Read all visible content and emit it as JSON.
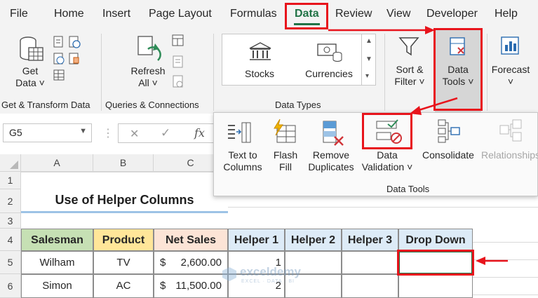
{
  "menu": {
    "tabs": [
      "File",
      "Home",
      "Insert",
      "Page Layout",
      "Formulas",
      "Data",
      "Review",
      "View",
      "Developer",
      "Help"
    ],
    "active": "Data"
  },
  "ribbon": {
    "get_data": {
      "line1": "Get",
      "line2": "Data ˅"
    },
    "group_get_transform": "Get & Transform Data",
    "refresh": {
      "line1": "Refresh",
      "line2": "All ˅"
    },
    "group_queries": "Queries & Connections",
    "stocks": "Stocks",
    "currencies": "Currencies",
    "group_data_types": "Data Types",
    "sort_filter": {
      "line1": "Sort &",
      "line2": "Filter ˅"
    },
    "data_tools": {
      "line1": "Data",
      "line2": "Tools ˅"
    },
    "forecast": {
      "line1": "Forecast",
      "line2": "˅"
    }
  },
  "popup": {
    "text_to_columns": {
      "line1": "Text to",
      "line2": "Columns"
    },
    "flash_fill": {
      "line1": "Flash",
      "line2": "Fill"
    },
    "remove_duplicates": {
      "line1": "Remove",
      "line2": "Duplicates"
    },
    "data_validation": {
      "line1": "Data",
      "line2": "Validation ˅"
    },
    "consolidate": "Consolidate",
    "relationships": "Relationships",
    "group_label": "Data Tools"
  },
  "formula_bar": {
    "name_box": "G5",
    "cancel": "✕",
    "enter": "✓",
    "fx": "fx"
  },
  "grid": {
    "columns": [
      "A",
      "B",
      "C"
    ],
    "rows": [
      "1",
      "2",
      "3",
      "4",
      "5",
      "6"
    ],
    "title": "Use of Helper Columns",
    "headers": [
      "Salesman",
      "Product",
      "Net Sales",
      "Helper 1",
      "Helper 2",
      "Helper 3",
      "Drop Down"
    ],
    "data": [
      {
        "salesman": "Wilham",
        "product": "TV",
        "currency": "$",
        "net_sales": "2,600.00",
        "helper1": "1"
      },
      {
        "salesman": "Simon",
        "product": "AC",
        "currency": "$",
        "net_sales": "11,500.00",
        "helper1": "2"
      }
    ]
  },
  "watermark": {
    "brand": "exceldemy",
    "tagline": "EXCEL · DATA · BI"
  },
  "colors": {
    "accent_green": "#217346",
    "annotation_red": "#e8141c",
    "salesman_fill": "#c6e0b4",
    "product_fill": "#ffe699",
    "netsales_fill": "#fce4d6",
    "helper_fill": "#ddebf7"
  }
}
